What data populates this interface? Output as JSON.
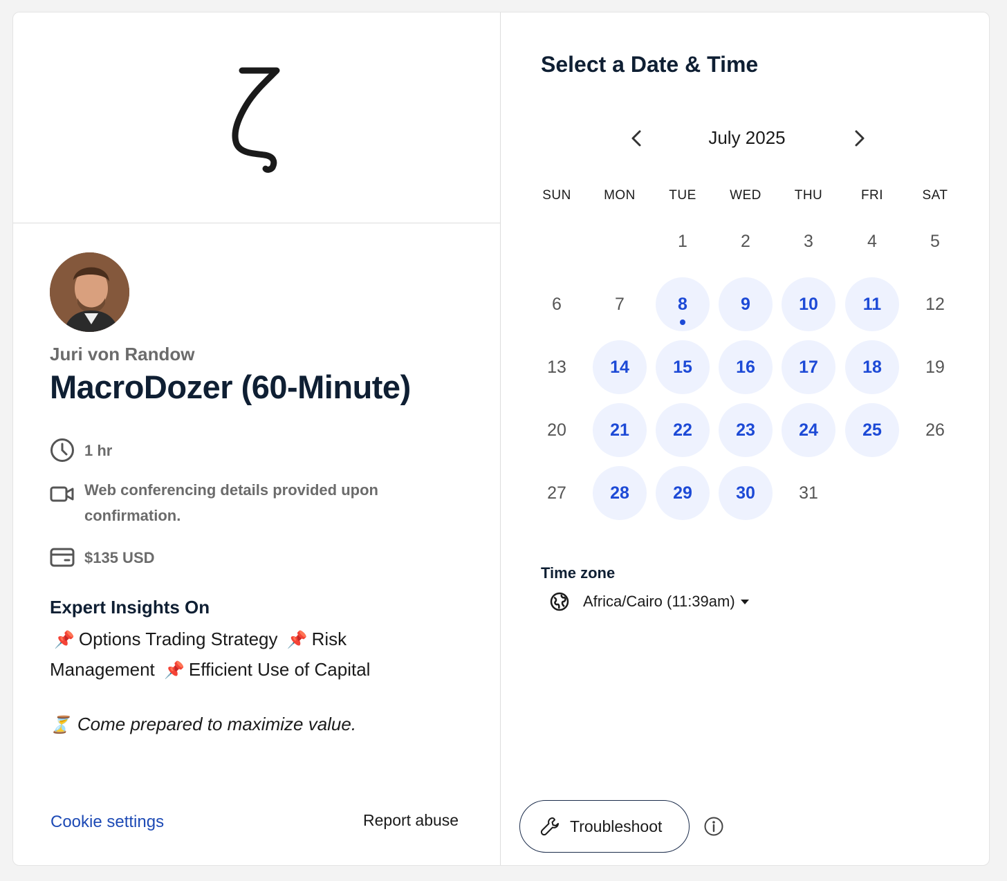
{
  "event": {
    "host_name": "Juri von Randow",
    "title": "MacroDozer (60-Minute)",
    "duration": "1 hr",
    "conferencing": "Web conferencing details provided upon confirmation.",
    "price": "$135 USD",
    "insights_heading": "Expert Insights On",
    "insights": [
      "Options Trading Strategy",
      "Risk",
      "Management",
      "Efficient Use of Capital"
    ],
    "pin_glyph": "📌",
    "prep_glyph": "⏳",
    "prep_note": "Come prepared to maximize value."
  },
  "footer": {
    "cookie_label": "Cookie settings",
    "report_label": "Report abuse"
  },
  "picker": {
    "title": "Select a Date & Time",
    "month_label": "July 2025",
    "weekdays": [
      "SUN",
      "MON",
      "TUE",
      "WED",
      "THU",
      "FRI",
      "SAT"
    ],
    "days": [
      {
        "label": "1",
        "available": false
      },
      {
        "label": "2",
        "available": false
      },
      {
        "label": "3",
        "available": false
      },
      {
        "label": "4",
        "available": false
      },
      {
        "label": "5",
        "available": false
      },
      {
        "label": "6",
        "available": false
      },
      {
        "label": "7",
        "available": false
      },
      {
        "label": "8",
        "available": true,
        "today": true
      },
      {
        "label": "9",
        "available": true
      },
      {
        "label": "10",
        "available": true
      },
      {
        "label": "11",
        "available": true
      },
      {
        "label": "12",
        "available": false
      },
      {
        "label": "13",
        "available": false
      },
      {
        "label": "14",
        "available": true
      },
      {
        "label": "15",
        "available": true
      },
      {
        "label": "16",
        "available": true
      },
      {
        "label": "17",
        "available": true
      },
      {
        "label": "18",
        "available": true
      },
      {
        "label": "19",
        "available": false
      },
      {
        "label": "20",
        "available": false
      },
      {
        "label": "21",
        "available": true
      },
      {
        "label": "22",
        "available": true
      },
      {
        "label": "23",
        "available": true
      },
      {
        "label": "24",
        "available": true
      },
      {
        "label": "25",
        "available": true
      },
      {
        "label": "26",
        "available": false
      },
      {
        "label": "27",
        "available": false
      },
      {
        "label": "28",
        "available": true
      },
      {
        "label": "29",
        "available": true
      },
      {
        "label": "30",
        "available": true
      },
      {
        "label": "31",
        "available": false
      }
    ],
    "timezone_label": "Time zone",
    "timezone_value": "Africa/Cairo (11:39am)",
    "troubleshoot_label": "Troubleshoot"
  },
  "colors": {
    "accent": "#1d4ad6",
    "available_bg": "#eef2fe",
    "heading": "#0f1f33",
    "link": "#1d4ab5"
  }
}
